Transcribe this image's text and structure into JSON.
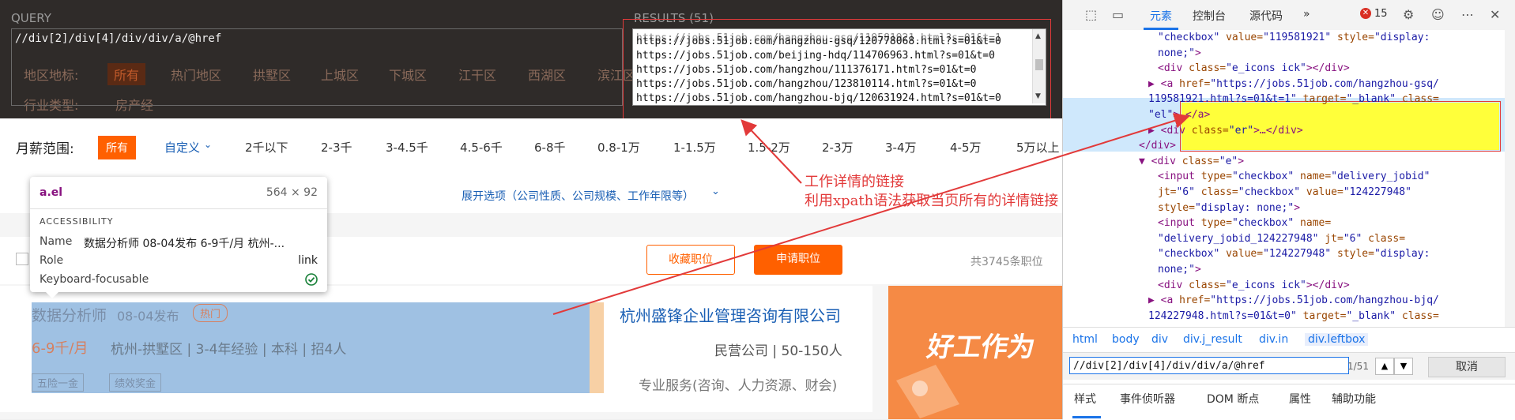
{
  "xpath_helper": {
    "query_label": "QUERY",
    "query_value": "//div[2]/div[4]/div/div/a/@href",
    "results_label": "RESULTS (51)",
    "results": [
      "https://jobs.51job.com/hangzhou-gsq/120778068.html?s=01&t=0",
      "https://jobs.51job.com/beijing-hdq/114706963.html?s=01&t=0",
      "https://jobs.51job.com/hangzhou/111376171.html?s=01&t=0",
      "https://jobs.51job.com/hangzhou/123810114.html?s=01&t=0",
      "https://jobs.51job.com/hangzhou-bjq/120631924.html?s=01&t=0"
    ]
  },
  "dark_filters": {
    "label": "地区地标:",
    "items": [
      "所有",
      "热门地区",
      "拱墅区",
      "上城区",
      "下城区",
      "江干区",
      "西湖区",
      "滨江区"
    ],
    "second_label": "行业类型:",
    "second_item": "房产经"
  },
  "salary": {
    "label": "月薪范围:",
    "options": [
      "所有",
      "自定义",
      "2千以下",
      "2-3千",
      "3-4.5千",
      "4.5-6千",
      "6-8千",
      "0.8-1万",
      "1-1.5万",
      "1.5-2万",
      "2-3万",
      "3-4万",
      "4-5万",
      "5万以上"
    ]
  },
  "expand_options": "展开选项（公司性质、公司规模、工作年限等）",
  "actions": {
    "favorite": "收藏职位",
    "apply": "申请职位",
    "total": "共3745条职位"
  },
  "job": {
    "title": "数据分析师",
    "date": "08-04发布",
    "hot_tag": "热门",
    "salary": "6-9千/月",
    "details": "杭州-拱墅区 | 3-4年经验 | 本科 | 招4人",
    "benefits": [
      "五险一金",
      "绩效奖金"
    ],
    "company": "杭州盛锋企业管理咨询有限公司",
    "company_type": "民营公司 | 50-150人",
    "industry": "专业服务(咨询、人力资源、财会)"
  },
  "ad": {
    "text": "好工作为"
  },
  "tooltip": {
    "selector": "a.el",
    "size": "564 × 92",
    "section": "ACCESSIBILITY",
    "name_label": "Name",
    "name_value": "数据分析师 08-04发布 6-9千/月 杭州-...",
    "role_label": "Role",
    "role_value": "link",
    "kbd_label": "Keyboard-focusable"
  },
  "annotation": {
    "line1": "工作详情的链接",
    "line2": "利用xpath语法获取当页所有的详情链接"
  },
  "devtools": {
    "tabs": [
      "元素",
      "控制台",
      "源代码"
    ],
    "more": "»",
    "error_count": "15",
    "dom_lines": [
      {
        "i": 10,
        "parts": [
          [
            "val",
            "\"checkbox\""
          ],
          [
            "attr",
            " value="
          ],
          [
            "val",
            "\"119581921\""
          ],
          [
            "attr",
            " style="
          ],
          [
            "val",
            "\"display:"
          ]
        ]
      },
      {
        "i": 10,
        "parts": [
          [
            "val",
            "none;\""
          ],
          [
            "tag",
            ">"
          ]
        ]
      },
      {
        "i": 10,
        "parts": [
          [
            "tag",
            "<div"
          ],
          [
            "attr",
            " class="
          ],
          [
            "val",
            "\"e_icons ick\""
          ],
          [
            "tag",
            "></div>"
          ]
        ]
      },
      {
        "i": 9,
        "parts": [
          [
            "tag",
            "▶ <a"
          ],
          [
            "attr",
            " href="
          ],
          [
            "val",
            "\"https://jobs.51job.com/hangzhou-gsq/"
          ]
        ]
      },
      {
        "i": 9,
        "parts": [
          [
            "val",
            "119581921.html?s=01&t=1\""
          ],
          [
            "attr",
            " target="
          ],
          [
            "val",
            "\"_blank\""
          ],
          [
            "attr",
            " class="
          ]
        ]
      },
      {
        "i": 9,
        "parts": [
          [
            "val",
            "\"el\""
          ],
          [
            "tag",
            ">…</a>"
          ]
        ]
      },
      {
        "i": 9,
        "parts": [
          [
            "tag",
            "▶ <div"
          ],
          [
            "attr",
            " class="
          ],
          [
            "val",
            "\"er\""
          ],
          [
            "tag",
            ">…</div>"
          ]
        ]
      },
      {
        "i": 8,
        "parts": [
          [
            "tag",
            "</div>"
          ]
        ]
      },
      {
        "i": 8,
        "parts": [
          [
            "tag",
            "▼ <div"
          ],
          [
            "attr",
            " class="
          ],
          [
            "val",
            "\"e\""
          ],
          [
            "tag",
            ">"
          ]
        ]
      },
      {
        "i": 10,
        "parts": [
          [
            "tag",
            "<input"
          ],
          [
            "attr",
            " type="
          ],
          [
            "val",
            "\"checkbox\""
          ],
          [
            "attr",
            " name="
          ],
          [
            "val",
            "\"delivery_jobid\""
          ]
        ]
      },
      {
        "i": 10,
        "parts": [
          [
            "attr",
            "jt="
          ],
          [
            "val",
            "\"6\""
          ],
          [
            "attr",
            " class="
          ],
          [
            "val",
            "\"checkbox\""
          ],
          [
            "attr",
            " value="
          ],
          [
            "val",
            "\"124227948\""
          ]
        ]
      },
      {
        "i": 10,
        "parts": [
          [
            "attr",
            "style="
          ],
          [
            "val",
            "\"display: none;\""
          ],
          [
            "tag",
            ">"
          ]
        ]
      },
      {
        "i": 10,
        "parts": [
          [
            "tag",
            "<input"
          ],
          [
            "attr",
            " type="
          ],
          [
            "val",
            "\"checkbox\""
          ],
          [
            "attr",
            " name="
          ]
        ]
      },
      {
        "i": 10,
        "parts": [
          [
            "val",
            "\"delivery_jobid_124227948\""
          ],
          [
            "attr",
            " jt="
          ],
          [
            "val",
            "\"6\""
          ],
          [
            "attr",
            " class="
          ]
        ]
      },
      {
        "i": 10,
        "parts": [
          [
            "val",
            "\"checkbox\""
          ],
          [
            "attr",
            " value="
          ],
          [
            "val",
            "\"124227948\""
          ],
          [
            "attr",
            " style="
          ],
          [
            "val",
            "\"display:"
          ]
        ]
      },
      {
        "i": 10,
        "parts": [
          [
            "val",
            "none;\""
          ],
          [
            "tag",
            ">"
          ]
        ]
      },
      {
        "i": 10,
        "parts": [
          [
            "tag",
            "<div"
          ],
          [
            "attr",
            " class="
          ],
          [
            "val",
            "\"e_icons ick\""
          ],
          [
            "tag",
            "></div>"
          ]
        ]
      },
      {
        "i": 9,
        "parts": [
          [
            "tag",
            "▶ <a"
          ],
          [
            "attr",
            " href="
          ],
          [
            "val",
            "\"https://jobs.51job.com/hangzhou-bjq/"
          ]
        ]
      },
      {
        "i": 9,
        "parts": [
          [
            "val",
            "124227948.html?s=01&t=0\""
          ],
          [
            "attr",
            " target="
          ],
          [
            "val",
            "\"_blank\""
          ],
          [
            "attr",
            " class="
          ]
        ]
      }
    ],
    "breadcrumbs": [
      "html",
      "body",
      "div",
      "div.j_result",
      "div.in",
      "div.leftbox"
    ],
    "search_value": "//div[2]/div[4]/div/div/a/@href",
    "search_count": "1/51",
    "cancel": "取消",
    "style_tabs": [
      "样式",
      "事件侦听器",
      "DOM 断点",
      "属性",
      "辅助功能"
    ]
  },
  "colors": {
    "accent": "#ff6000",
    "annotation": "#e23a3a",
    "devtools_blue": "#1a73e8"
  }
}
